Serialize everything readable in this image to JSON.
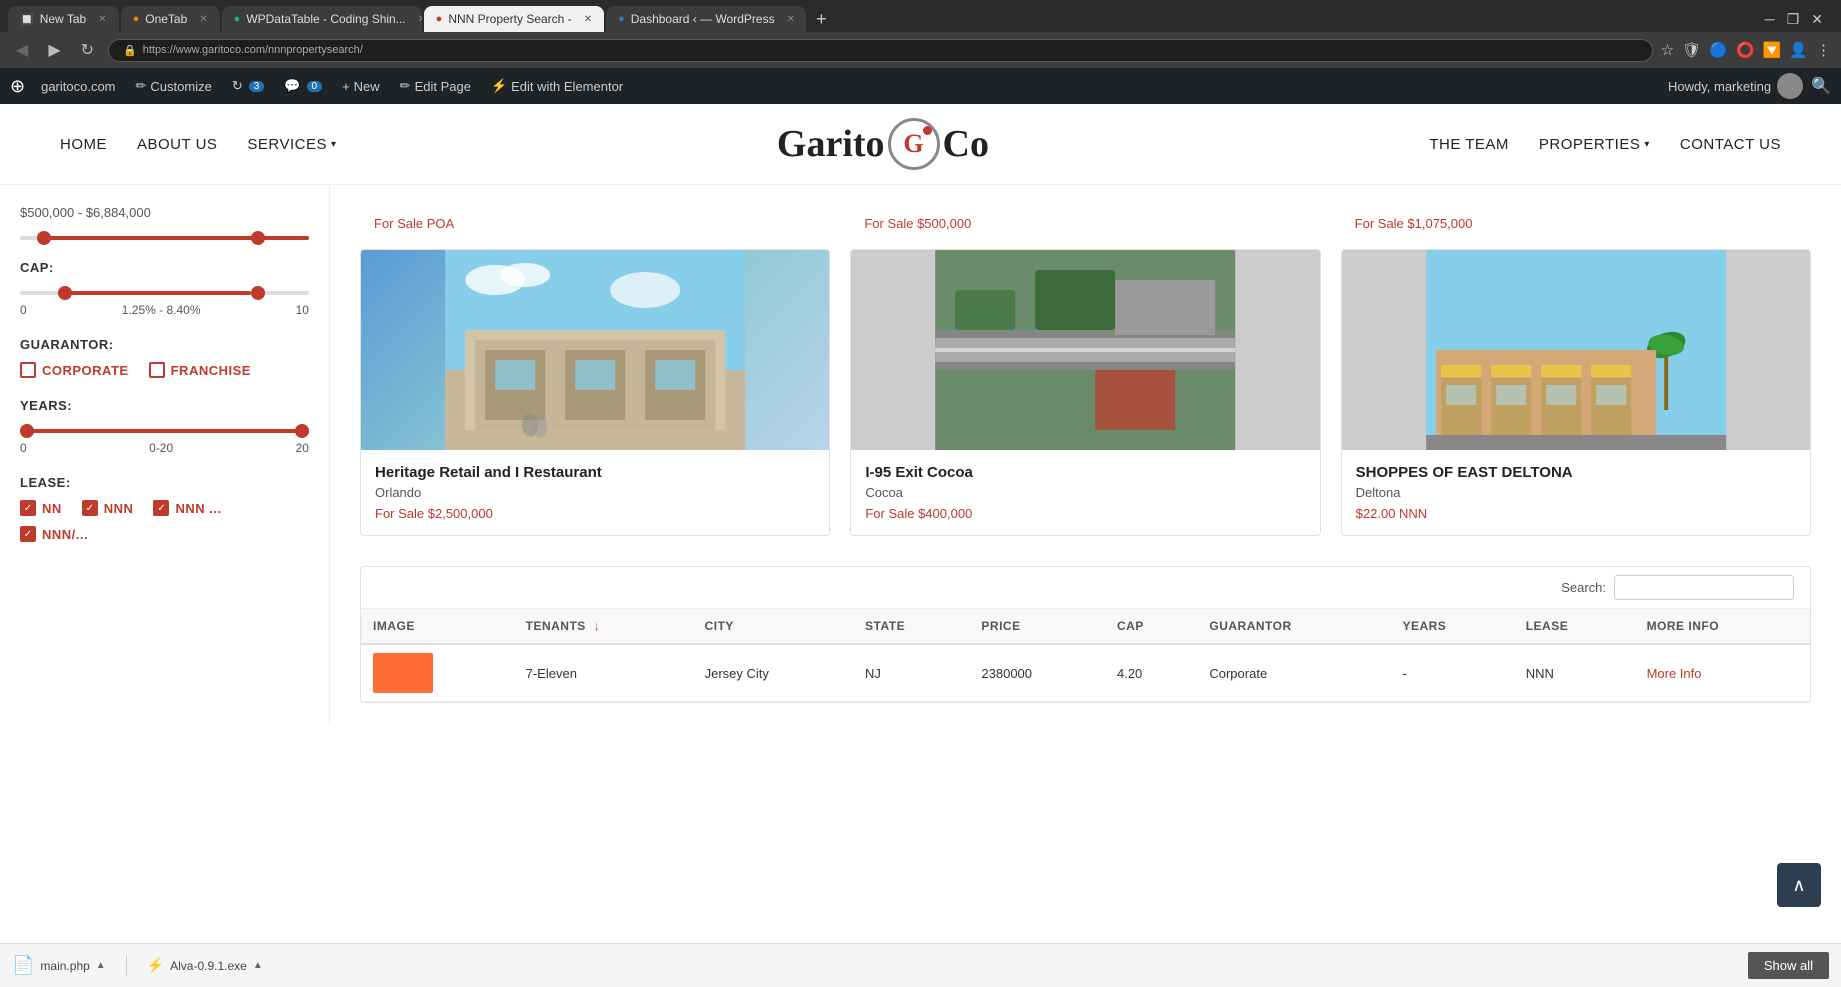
{
  "browser": {
    "tabs": [
      {
        "label": "New Tab",
        "active": false,
        "favicon": "🔲"
      },
      {
        "label": "OneTab",
        "active": false,
        "favicon": "🟠"
      },
      {
        "label": "WPDataTable - Coding Shin...",
        "active": false,
        "favicon": "📊"
      },
      {
        "label": "NNN Property Search -",
        "active": true,
        "favicon": "🔴"
      },
      {
        "label": "Dashboard ‹ — WordPress",
        "active": false,
        "favicon": "🔵"
      }
    ],
    "address": "https://www.garitoco.com/nnnpropertysearch/"
  },
  "wp_admin_bar": {
    "wp_label": "W",
    "site_label": "garitoco.com",
    "customize_label": "Customize",
    "updates_count": "3",
    "comments_count": "0",
    "new_label": "New",
    "edit_page_label": "Edit Page",
    "elementor_label": "Edit with Elementor",
    "howdy_label": "Howdy, marketing"
  },
  "nav": {
    "home": "HOME",
    "about": "ABOUT US",
    "services": "SERVICES",
    "logo_text_left": "Garito ",
    "logo_text_right": " Co",
    "team": "THE TEAM",
    "properties": "PROPERTIES",
    "contact": "CONTACT US"
  },
  "sidebar": {
    "cap_label": "CAP:",
    "cap_range": "1.25% - 8.40%",
    "cap_min": "0",
    "cap_max": "10",
    "guarantor_label": "GUARANTOR:",
    "corporate_label": "CORPORATE",
    "franchise_label": "FRANCHISE",
    "years_label": "YEARS:",
    "years_range": "0-20",
    "years_min": "0",
    "years_max": "20",
    "lease_label": "LEASE:",
    "nn_label": "NN",
    "nnn_label": "NNN",
    "nnn2_label": "NNN ...",
    "nnn3_label": "NNN/..."
  },
  "price_strips": [
    {
      "text": "For Sale POA"
    },
    {
      "text": "For Sale $500,000"
    },
    {
      "text": "For Sale $1,075,000"
    }
  ],
  "properties": [
    {
      "title": "Heritage Retail and I Restaurant",
      "city": "Orlando",
      "price": "For Sale $2,500,000",
      "image_color": "#7eb8c4"
    },
    {
      "title": "I-95 Exit Cocoa",
      "city": "Cocoa",
      "price": "For Sale $400,000",
      "image_color": "#8ab89a"
    },
    {
      "title": "SHOPPES OF EAST DELTONA",
      "city": "Deltona",
      "price": "$22.00 NNN",
      "image_color": "#c8a882"
    }
  ],
  "table": {
    "search_label": "Search:",
    "columns": [
      "IMAGE",
      "TENANTS",
      "CITY",
      "STATE",
      "PRICE",
      "CAP",
      "GUARANTOR",
      "YEARS",
      "LEASE",
      "MORE INFO"
    ],
    "rows": [
      {
        "image": "orange",
        "tenants": "7-Eleven",
        "city": "Jersey City",
        "state": "NJ",
        "price": "2380000",
        "cap": "4.20",
        "guarantor": "Corporate",
        "years": "-",
        "lease": "NNN",
        "more_info": "More Info"
      }
    ]
  },
  "back_to_top": "∧",
  "bottom_bar": {
    "file1": "main.php",
    "file2": "Alva-0.9.1.exe",
    "show_all": "Show all"
  }
}
